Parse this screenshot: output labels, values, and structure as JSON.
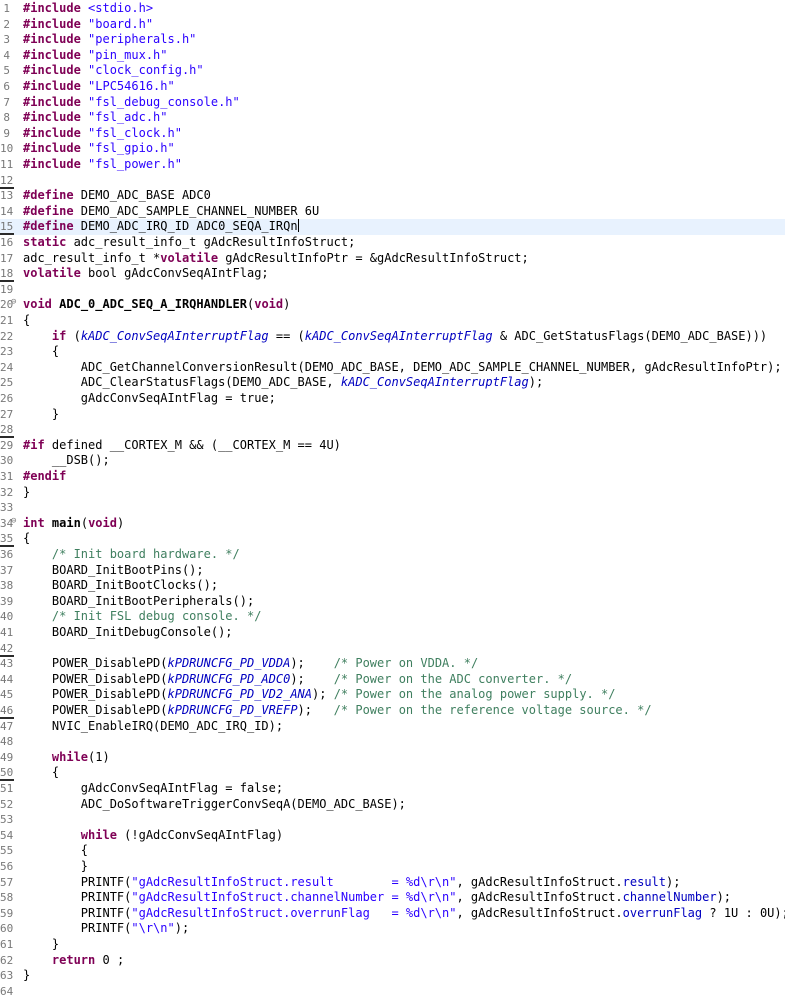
{
  "editor": {
    "cursor_line": 15,
    "colors": {
      "keyword": "#7f0055",
      "string": "#2a00ff",
      "comment": "#3f7f5f",
      "enum": "#0000c0",
      "field": "#0000c0",
      "line_number": "#787878",
      "current_line": "#e8f2fe"
    },
    "lines": [
      {
        "n": "1",
        "fold": "",
        "mark": false,
        "tokens": [
          {
            "c": "pp",
            "t": "#include"
          },
          {
            "c": "plain",
            "t": " "
          },
          {
            "c": "inc",
            "t": "<stdio.h>"
          }
        ]
      },
      {
        "n": "2",
        "fold": "",
        "mark": false,
        "tokens": [
          {
            "c": "pp",
            "t": "#include"
          },
          {
            "c": "plain",
            "t": " "
          },
          {
            "c": "str",
            "t": "\"board.h\""
          }
        ]
      },
      {
        "n": "3",
        "fold": "",
        "mark": false,
        "tokens": [
          {
            "c": "pp",
            "t": "#include"
          },
          {
            "c": "plain",
            "t": " "
          },
          {
            "c": "str",
            "t": "\"peripherals.h\""
          }
        ]
      },
      {
        "n": "4",
        "fold": "",
        "mark": false,
        "tokens": [
          {
            "c": "pp",
            "t": "#include"
          },
          {
            "c": "plain",
            "t": " "
          },
          {
            "c": "str",
            "t": "\"pin_mux.h\""
          }
        ]
      },
      {
        "n": "5",
        "fold": "",
        "mark": false,
        "tokens": [
          {
            "c": "pp",
            "t": "#include"
          },
          {
            "c": "plain",
            "t": " "
          },
          {
            "c": "str",
            "t": "\"clock_config.h\""
          }
        ]
      },
      {
        "n": "6",
        "fold": "",
        "mark": false,
        "tokens": [
          {
            "c": "pp",
            "t": "#include"
          },
          {
            "c": "plain",
            "t": " "
          },
          {
            "c": "str",
            "t": "\"LPC54616.h\""
          }
        ]
      },
      {
        "n": "7",
        "fold": "",
        "mark": false,
        "tokens": [
          {
            "c": "pp",
            "t": "#include"
          },
          {
            "c": "plain",
            "t": " "
          },
          {
            "c": "str",
            "t": "\"fsl_debug_console.h\""
          }
        ]
      },
      {
        "n": "8",
        "fold": "",
        "mark": false,
        "tokens": [
          {
            "c": "pp",
            "t": "#include"
          },
          {
            "c": "plain",
            "t": " "
          },
          {
            "c": "str",
            "t": "\"fsl_adc.h\""
          }
        ]
      },
      {
        "n": "9",
        "fold": "",
        "mark": false,
        "tokens": [
          {
            "c": "pp",
            "t": "#include"
          },
          {
            "c": "plain",
            "t": " "
          },
          {
            "c": "str",
            "t": "\"fsl_clock.h\""
          }
        ]
      },
      {
        "n": "10",
        "fold": "",
        "mark": false,
        "tokens": [
          {
            "c": "pp",
            "t": "#include"
          },
          {
            "c": "plain",
            "t": " "
          },
          {
            "c": "str",
            "t": "\"fsl_gpio.h\""
          }
        ]
      },
      {
        "n": "11",
        "fold": "",
        "mark": false,
        "tokens": [
          {
            "c": "pp",
            "t": "#include"
          },
          {
            "c": "plain",
            "t": " "
          },
          {
            "c": "str",
            "t": "\"fsl_power.h\""
          }
        ]
      },
      {
        "n": "12",
        "fold": "",
        "mark": true,
        "tokens": []
      },
      {
        "n": "13",
        "fold": "",
        "mark": false,
        "tokens": [
          {
            "c": "pp",
            "t": "#define"
          },
          {
            "c": "plain",
            "t": " DEMO_ADC_BASE ADC0"
          }
        ]
      },
      {
        "n": "14",
        "fold": "",
        "mark": false,
        "tokens": [
          {
            "c": "pp",
            "t": "#define"
          },
          {
            "c": "plain",
            "t": " DEMO_ADC_SAMPLE_CHANNEL_NUMBER 6U"
          }
        ]
      },
      {
        "n": "15",
        "fold": "",
        "mark": true,
        "tokens": [
          {
            "c": "pp",
            "t": "#define"
          },
          {
            "c": "plain",
            "t": " DEMO_ADC_IRQ_ID ADC0_SEQA_IRQn"
          }
        ]
      },
      {
        "n": "16",
        "fold": "",
        "mark": false,
        "tokens": [
          {
            "c": "kw",
            "t": "static"
          },
          {
            "c": "plain",
            "t": " adc_result_info_t gAdcResultInfoStruct;"
          }
        ]
      },
      {
        "n": "17",
        "fold": "",
        "mark": false,
        "tokens": [
          {
            "c": "plain",
            "t": "adc_result_info_t *"
          },
          {
            "c": "kw",
            "t": "volatile"
          },
          {
            "c": "plain",
            "t": " gAdcResultInfoPtr = &gAdcResultInfoStruct;"
          }
        ]
      },
      {
        "n": "18",
        "fold": "",
        "mark": true,
        "tokens": [
          {
            "c": "kw",
            "t": "volatile"
          },
          {
            "c": "plain",
            "t": " bool gAdcConvSeqAIntFlag;"
          }
        ]
      },
      {
        "n": "19",
        "fold": "",
        "mark": false,
        "tokens": []
      },
      {
        "n": "20",
        "fold": "⊖",
        "mark": false,
        "tokens": [
          {
            "c": "kw",
            "t": "void"
          },
          {
            "c": "plain",
            "t": " "
          },
          {
            "c": "fn",
            "t": "ADC_0_ADC_SEQ_A_IRQHANDLER"
          },
          {
            "c": "plain",
            "t": "("
          },
          {
            "c": "kw",
            "t": "void"
          },
          {
            "c": "plain",
            "t": ")"
          }
        ]
      },
      {
        "n": "21",
        "fold": "",
        "mark": false,
        "tokens": [
          {
            "c": "plain",
            "t": "{"
          }
        ]
      },
      {
        "n": "22",
        "fold": "",
        "mark": false,
        "tokens": [
          {
            "c": "plain",
            "t": "    "
          },
          {
            "c": "kw",
            "t": "if"
          },
          {
            "c": "plain",
            "t": " ("
          },
          {
            "c": "en",
            "t": "kADC_ConvSeqAInterruptFlag"
          },
          {
            "c": "plain",
            "t": " == ("
          },
          {
            "c": "en",
            "t": "kADC_ConvSeqAInterruptFlag"
          },
          {
            "c": "plain",
            "t": " & ADC_GetStatusFlags(DEMO_ADC_BASE)))"
          }
        ]
      },
      {
        "n": "23",
        "fold": "",
        "mark": false,
        "tokens": [
          {
            "c": "plain",
            "t": "    {"
          }
        ]
      },
      {
        "n": "24",
        "fold": "",
        "mark": false,
        "tokens": [
          {
            "c": "plain",
            "t": "        ADC_GetChannelConversionResult(DEMO_ADC_BASE, DEMO_ADC_SAMPLE_CHANNEL_NUMBER, gAdcResultInfoPtr);"
          }
        ]
      },
      {
        "n": "25",
        "fold": "",
        "mark": false,
        "tokens": [
          {
            "c": "plain",
            "t": "        ADC_ClearStatusFlags(DEMO_ADC_BASE, "
          },
          {
            "c": "en",
            "t": "kADC_ConvSeqAInterruptFlag"
          },
          {
            "c": "plain",
            "t": ");"
          }
        ]
      },
      {
        "n": "26",
        "fold": "",
        "mark": false,
        "tokens": [
          {
            "c": "plain",
            "t": "        gAdcConvSeqAIntFlag = true;"
          }
        ]
      },
      {
        "n": "27",
        "fold": "",
        "mark": false,
        "tokens": [
          {
            "c": "plain",
            "t": "    }"
          }
        ]
      },
      {
        "n": "28",
        "fold": "",
        "mark": true,
        "tokens": []
      },
      {
        "n": "29",
        "fold": "",
        "mark": false,
        "tokens": [
          {
            "c": "pp",
            "t": "#if"
          },
          {
            "c": "plain",
            "t": " defined __CORTEX_M && (__CORTEX_M == 4U)"
          }
        ]
      },
      {
        "n": "30",
        "fold": "",
        "mark": false,
        "tokens": [
          {
            "c": "plain",
            "t": "    __DSB();"
          }
        ]
      },
      {
        "n": "31",
        "fold": "",
        "mark": false,
        "tokens": [
          {
            "c": "pp",
            "t": "#endif"
          }
        ]
      },
      {
        "n": "32",
        "fold": "",
        "mark": false,
        "tokens": [
          {
            "c": "plain",
            "t": "}"
          }
        ]
      },
      {
        "n": "33",
        "fold": "",
        "mark": false,
        "tokens": []
      },
      {
        "n": "34",
        "fold": "⊖",
        "mark": false,
        "tokens": [
          {
            "c": "kw",
            "t": "int"
          },
          {
            "c": "plain",
            "t": " "
          },
          {
            "c": "fn",
            "t": "main"
          },
          {
            "c": "plain",
            "t": "("
          },
          {
            "c": "kw",
            "t": "void"
          },
          {
            "c": "plain",
            "t": ")"
          }
        ]
      },
      {
        "n": "35",
        "fold": "",
        "mark": true,
        "tokens": [
          {
            "c": "plain",
            "t": "{"
          }
        ]
      },
      {
        "n": "36",
        "fold": "",
        "mark": false,
        "tokens": [
          {
            "c": "plain",
            "t": "    "
          },
          {
            "c": "cm",
            "t": "/* Init board hardware. */"
          }
        ]
      },
      {
        "n": "37",
        "fold": "",
        "mark": false,
        "tokens": [
          {
            "c": "plain",
            "t": "    BOARD_InitBootPins();"
          }
        ]
      },
      {
        "n": "38",
        "fold": "",
        "mark": false,
        "tokens": [
          {
            "c": "plain",
            "t": "    BOARD_InitBootClocks();"
          }
        ]
      },
      {
        "n": "39",
        "fold": "",
        "mark": false,
        "tokens": [
          {
            "c": "plain",
            "t": "    BOARD_InitBootPeripherals();"
          }
        ]
      },
      {
        "n": "40",
        "fold": "",
        "mark": false,
        "tokens": [
          {
            "c": "plain",
            "t": "    "
          },
          {
            "c": "cm",
            "t": "/* Init FSL debug console. */"
          }
        ]
      },
      {
        "n": "41",
        "fold": "",
        "mark": false,
        "tokens": [
          {
            "c": "plain",
            "t": "    BOARD_InitDebugConsole();"
          }
        ]
      },
      {
        "n": "42",
        "fold": "",
        "mark": true,
        "tokens": []
      },
      {
        "n": "43",
        "fold": "",
        "mark": false,
        "tokens": [
          {
            "c": "plain",
            "t": "    POWER_DisablePD("
          },
          {
            "c": "en",
            "t": "kPDRUNCFG_PD_VDDA"
          },
          {
            "c": "plain",
            "t": ");    "
          },
          {
            "c": "cm",
            "t": "/* Power on VDDA. */"
          }
        ]
      },
      {
        "n": "44",
        "fold": "",
        "mark": false,
        "tokens": [
          {
            "c": "plain",
            "t": "    POWER_DisablePD("
          },
          {
            "c": "en",
            "t": "kPDRUNCFG_PD_ADC0"
          },
          {
            "c": "plain",
            "t": ");    "
          },
          {
            "c": "cm",
            "t": "/* Power on the ADC converter. */"
          }
        ]
      },
      {
        "n": "45",
        "fold": "",
        "mark": false,
        "tokens": [
          {
            "c": "plain",
            "t": "    POWER_DisablePD("
          },
          {
            "c": "en",
            "t": "kPDRUNCFG_PD_VD2_ANA"
          },
          {
            "c": "plain",
            "t": "); "
          },
          {
            "c": "cm",
            "t": "/* Power on the analog power supply. */"
          }
        ]
      },
      {
        "n": "46",
        "fold": "",
        "mark": true,
        "tokens": [
          {
            "c": "plain",
            "t": "    POWER_DisablePD("
          },
          {
            "c": "en",
            "t": "kPDRUNCFG_PD_VREFP"
          },
          {
            "c": "plain",
            "t": ");   "
          },
          {
            "c": "cm",
            "t": "/* Power on the reference voltage source. */"
          }
        ]
      },
      {
        "n": "47",
        "fold": "",
        "mark": false,
        "tokens": [
          {
            "c": "plain",
            "t": "    NVIC_EnableIRQ(DEMO_ADC_IRQ_ID);"
          }
        ]
      },
      {
        "n": "48",
        "fold": "",
        "mark": false,
        "tokens": []
      },
      {
        "n": "49",
        "fold": "",
        "mark": false,
        "tokens": [
          {
            "c": "plain",
            "t": "    "
          },
          {
            "c": "kw",
            "t": "while"
          },
          {
            "c": "plain",
            "t": "(1)"
          }
        ]
      },
      {
        "n": "50",
        "fold": "",
        "mark": true,
        "tokens": [
          {
            "c": "plain",
            "t": "    {"
          }
        ]
      },
      {
        "n": "51",
        "fold": "",
        "mark": false,
        "tokens": [
          {
            "c": "plain",
            "t": "        gAdcConvSeqAIntFlag = false;"
          }
        ]
      },
      {
        "n": "52",
        "fold": "",
        "mark": false,
        "tokens": [
          {
            "c": "plain",
            "t": "        ADC_DoSoftwareTriggerConvSeqA(DEMO_ADC_BASE);"
          }
        ]
      },
      {
        "n": "53",
        "fold": "",
        "mark": false,
        "tokens": []
      },
      {
        "n": "54",
        "fold": "",
        "mark": false,
        "tokens": [
          {
            "c": "plain",
            "t": "        "
          },
          {
            "c": "kw",
            "t": "while"
          },
          {
            "c": "plain",
            "t": " (!gAdcConvSeqAIntFlag)"
          }
        ]
      },
      {
        "n": "55",
        "fold": "",
        "mark": false,
        "tokens": [
          {
            "c": "plain",
            "t": "        {"
          }
        ]
      },
      {
        "n": "56",
        "fold": "",
        "mark": false,
        "tokens": [
          {
            "c": "plain",
            "t": "        }"
          }
        ]
      },
      {
        "n": "57",
        "fold": "",
        "mark": false,
        "tokens": [
          {
            "c": "plain",
            "t": "        PRINTF("
          },
          {
            "c": "str",
            "t": "\"gAdcResultInfoStruct.result        = %d\\r\\n\""
          },
          {
            "c": "plain",
            "t": ", gAdcResultInfoStruct."
          },
          {
            "c": "fld",
            "t": "result"
          },
          {
            "c": "plain",
            "t": ");"
          }
        ]
      },
      {
        "n": "58",
        "fold": "",
        "mark": false,
        "tokens": [
          {
            "c": "plain",
            "t": "        PRINTF("
          },
          {
            "c": "str",
            "t": "\"gAdcResultInfoStruct.channelNumber = %d\\r\\n\""
          },
          {
            "c": "plain",
            "t": ", gAdcResultInfoStruct."
          },
          {
            "c": "fld",
            "t": "channelNumber"
          },
          {
            "c": "plain",
            "t": ");"
          }
        ]
      },
      {
        "n": "59",
        "fold": "",
        "mark": false,
        "tokens": [
          {
            "c": "plain",
            "t": "        PRINTF("
          },
          {
            "c": "str",
            "t": "\"gAdcResultInfoStruct.overrunFlag   = %d\\r\\n\""
          },
          {
            "c": "plain",
            "t": ", gAdcResultInfoStruct."
          },
          {
            "c": "fld",
            "t": "overrunFlag"
          },
          {
            "c": "plain",
            "t": " ? 1U : 0U);"
          }
        ]
      },
      {
        "n": "60",
        "fold": "",
        "mark": false,
        "tokens": [
          {
            "c": "plain",
            "t": "        PRINTF("
          },
          {
            "c": "str",
            "t": "\"\\r\\n\""
          },
          {
            "c": "plain",
            "t": ");"
          }
        ]
      },
      {
        "n": "61",
        "fold": "",
        "mark": false,
        "tokens": [
          {
            "c": "plain",
            "t": "    }"
          }
        ]
      },
      {
        "n": "62",
        "fold": "",
        "mark": false,
        "tokens": [
          {
            "c": "plain",
            "t": "    "
          },
          {
            "c": "kw",
            "t": "return"
          },
          {
            "c": "plain",
            "t": " 0 ;"
          }
        ]
      },
      {
        "n": "63",
        "fold": "",
        "mark": false,
        "tokens": [
          {
            "c": "plain",
            "t": "}"
          }
        ]
      },
      {
        "n": "64",
        "fold": "",
        "mark": false,
        "tokens": []
      }
    ]
  }
}
